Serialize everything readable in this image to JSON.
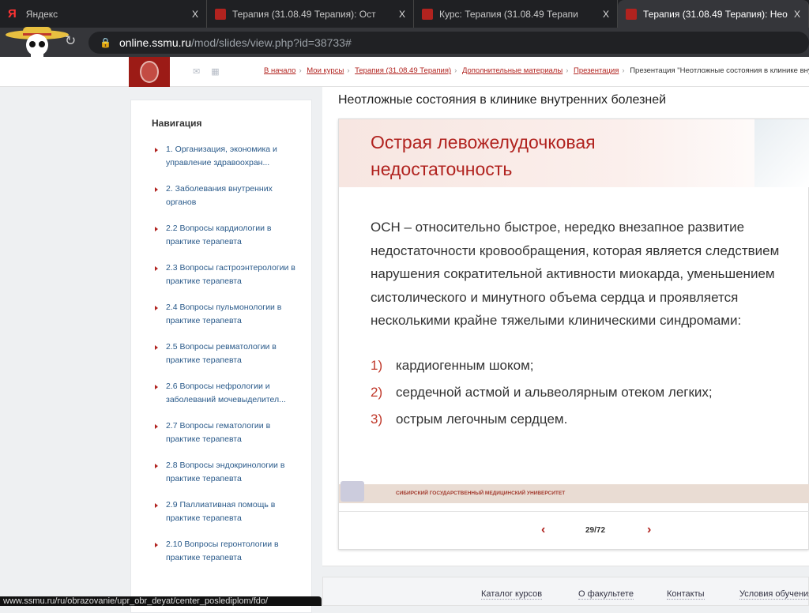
{
  "browser": {
    "tabs": [
      {
        "label": "Яндекс",
        "icon": "yandex-icon",
        "active": false
      },
      {
        "label": "Терапия (31.08.49 Терапия): Ост",
        "icon": "ssmu-favicon",
        "active": false
      },
      {
        "label": "Курс: Терапия (31.08.49 Терапи",
        "icon": "ssmu-favicon",
        "active": false
      },
      {
        "label": "Терапия (31.08.49 Терапия): Нео",
        "icon": "ssmu-favicon",
        "active": true
      }
    ],
    "close_glyph": "X",
    "url_host": "online.ssmu.ru",
    "url_path": "/mod/slides/view.php?id=38733#",
    "status_url": "www.ssmu.ru/ru/obrazovanie/upr_obr_deyat/center_poslediplom/fdo/"
  },
  "breadcrumb": [
    "В начало",
    "Мои курсы",
    "Терапия (31.08.49 Терапия)",
    "Дополнительные материалы",
    "Презентация"
  ],
  "breadcrumb_current": "Презентация \"Неотложные состояния в клинике внутренних болезней\"",
  "sidebar": {
    "title": "Навигация",
    "items": [
      "1. Организация, экономика и управление здравоохран...",
      "2. Заболевания внутренних органов",
      "2.2 Вопросы кардиологии в практике терапевта",
      "2.3 Вопросы гастроэнтерологии в практике терапевта",
      "2.4 Вопросы пульмонологии в практике терапевта",
      "2.5 Вопросы ревматологии в практике терапевта",
      "2.6 Вопросы нефрологии и заболеваний мочевыделител...",
      "2.7 Вопросы гематологии в практике терапевта",
      "2.8 Вопросы эндокринологии в практике терапевта",
      "2.9 Паллиативная помощь в практике терапевта",
      "2.10 Вопросы геронтологии в практике терапевта"
    ]
  },
  "page_title": "Неотложные состояния в клинике внутренних болезней",
  "slide": {
    "title_line1": "Острая левожелудочковая",
    "title_line2": "недостаточность",
    "body": "ОСН – относительно быстрое, нередко внезапное развитие недостаточности кровообращения, которая является следствием нарушения сократительной активности миокарда, уменьшением систолического и минутного объема сердца и проявляется несколькими крайне тяжелыми клиническими синдромами:",
    "items": [
      {
        "n": "1)",
        "text": "кардиогенным шоком;"
      },
      {
        "n": "2)",
        "text": "сердечной астмой и альвеолярным отеком легких;"
      },
      {
        "n": "3)",
        "text": "острым легочным сердцем."
      }
    ],
    "footer": "СИБИРСКИЙ ГОСУДАРСТВЕННЫЙ МЕДИЦИНСКИЙ УНИВЕРСИТЕТ"
  },
  "pager": {
    "prev": "‹",
    "next": "›",
    "current": "29/72"
  },
  "footer": [
    "Каталог курсов",
    "О факультете",
    "Контакты",
    "Условия обучения"
  ],
  "colors": {
    "accent": "#b1231f",
    "tabbar": "#1f2023",
    "link": "#2a5a8a"
  }
}
